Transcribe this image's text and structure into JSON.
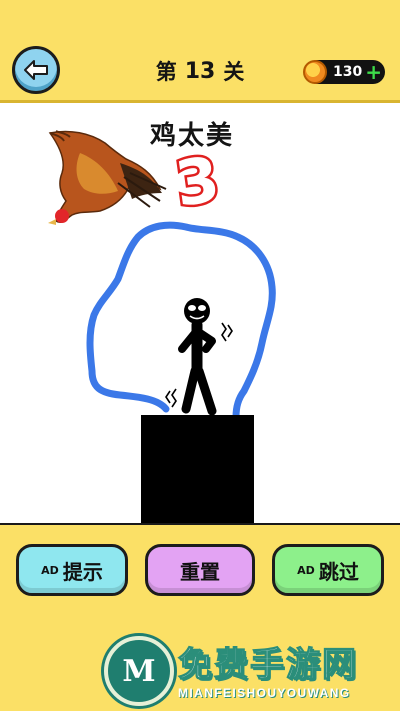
{
  "header": {
    "level_prefix": "第",
    "level_number": "13",
    "level_suffix": "关",
    "coins": "130",
    "coin_plus": "+"
  },
  "stage": {
    "caption": "鸡太美",
    "big_number": "3"
  },
  "buttons": {
    "hint": {
      "ad": "AD",
      "label": "提示"
    },
    "reset": {
      "label": "重置"
    },
    "skip": {
      "ad": "AD",
      "label": "跳过"
    }
  },
  "watermark": {
    "logo_letter": "M",
    "title": "免费手游网",
    "subtitle": "MIANFEISHOUYOUWANG"
  },
  "colors": {
    "background": "#fbe066",
    "drawn_line": "#3b78e8",
    "number_red": "#e0201f",
    "hint_button": "#8fe7ef",
    "reset_button": "#e3a3f3",
    "skip_button": "#8df08b"
  }
}
